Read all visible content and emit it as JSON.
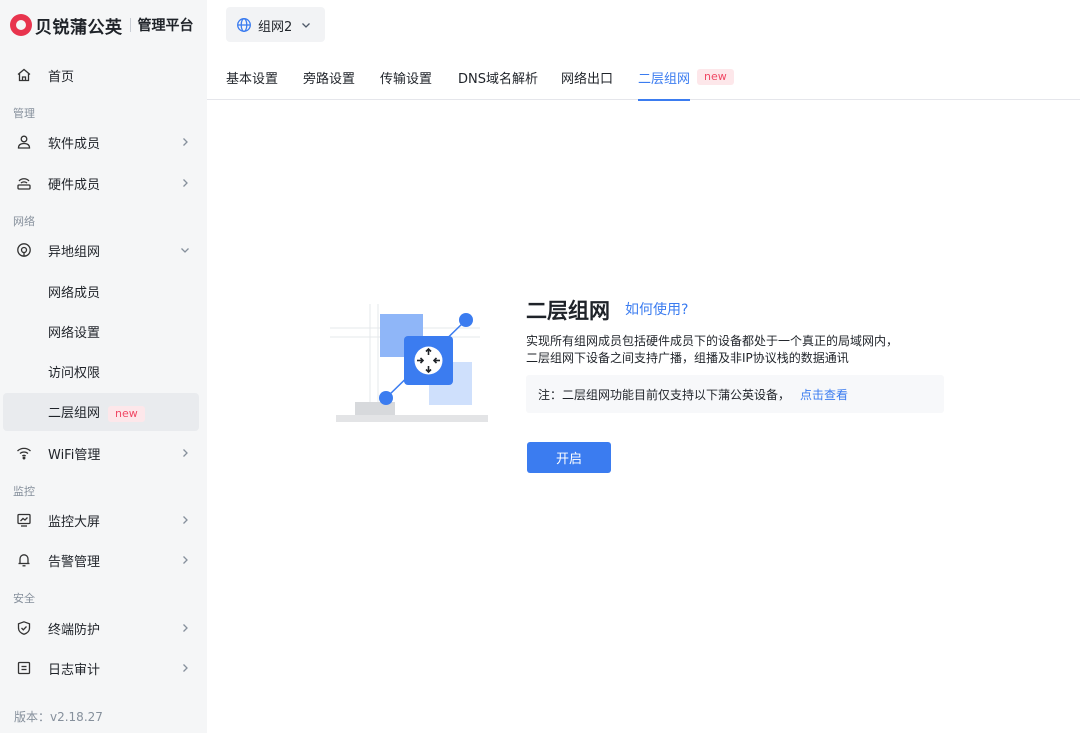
{
  "brand": {
    "name": "贝锐蒲公英",
    "subtitle": "管理平台"
  },
  "sidebar": {
    "home": "首页",
    "sections": {
      "manage": "管理",
      "network": "网络",
      "monitor": "监控",
      "security": "安全"
    },
    "items": {
      "software_members": "软件成员",
      "hardware_members": "硬件成员",
      "remote_network": "异地组网",
      "network_members": "网络成员",
      "network_settings": "网络设置",
      "access_control": "访问权限",
      "layer2_network": "二层组网",
      "wifi_management": "WiFi管理",
      "monitor_screen": "监控大屏",
      "alert_management": "告警管理",
      "endpoint_protection": "终端防护",
      "log_audit": "日志审计"
    },
    "new_badge": "new",
    "version": "版本：v2.18.27"
  },
  "header": {
    "network_selector": "组网2"
  },
  "tabs": [
    {
      "label": "基本设置"
    },
    {
      "label": "旁路设置"
    },
    {
      "label": "传输设置"
    },
    {
      "label": "DNS域名解析"
    },
    {
      "label": "网络出口"
    },
    {
      "label": "二层组网",
      "badge": "new"
    }
  ],
  "feature": {
    "title": "二层组网",
    "help_link": "如何使用?",
    "description_line1": "实现所有组网成员包括硬件成员下的设备都处于一个真正的局域网内，",
    "description_line2": "二层组网下设备之间支持广播，组播及非IP协议栈的数据通讯",
    "note_text": "注：二层组网功能目前仅支持以下蒲公英设备，",
    "note_link": "点击查看",
    "enable_button": "开启"
  },
  "colors": {
    "accent": "#3b7cf0",
    "brand_red": "#e8344e",
    "badge_bg": "#fde7ea",
    "badge_text": "#f04864",
    "sidebar_bg": "#f5f6f7"
  }
}
